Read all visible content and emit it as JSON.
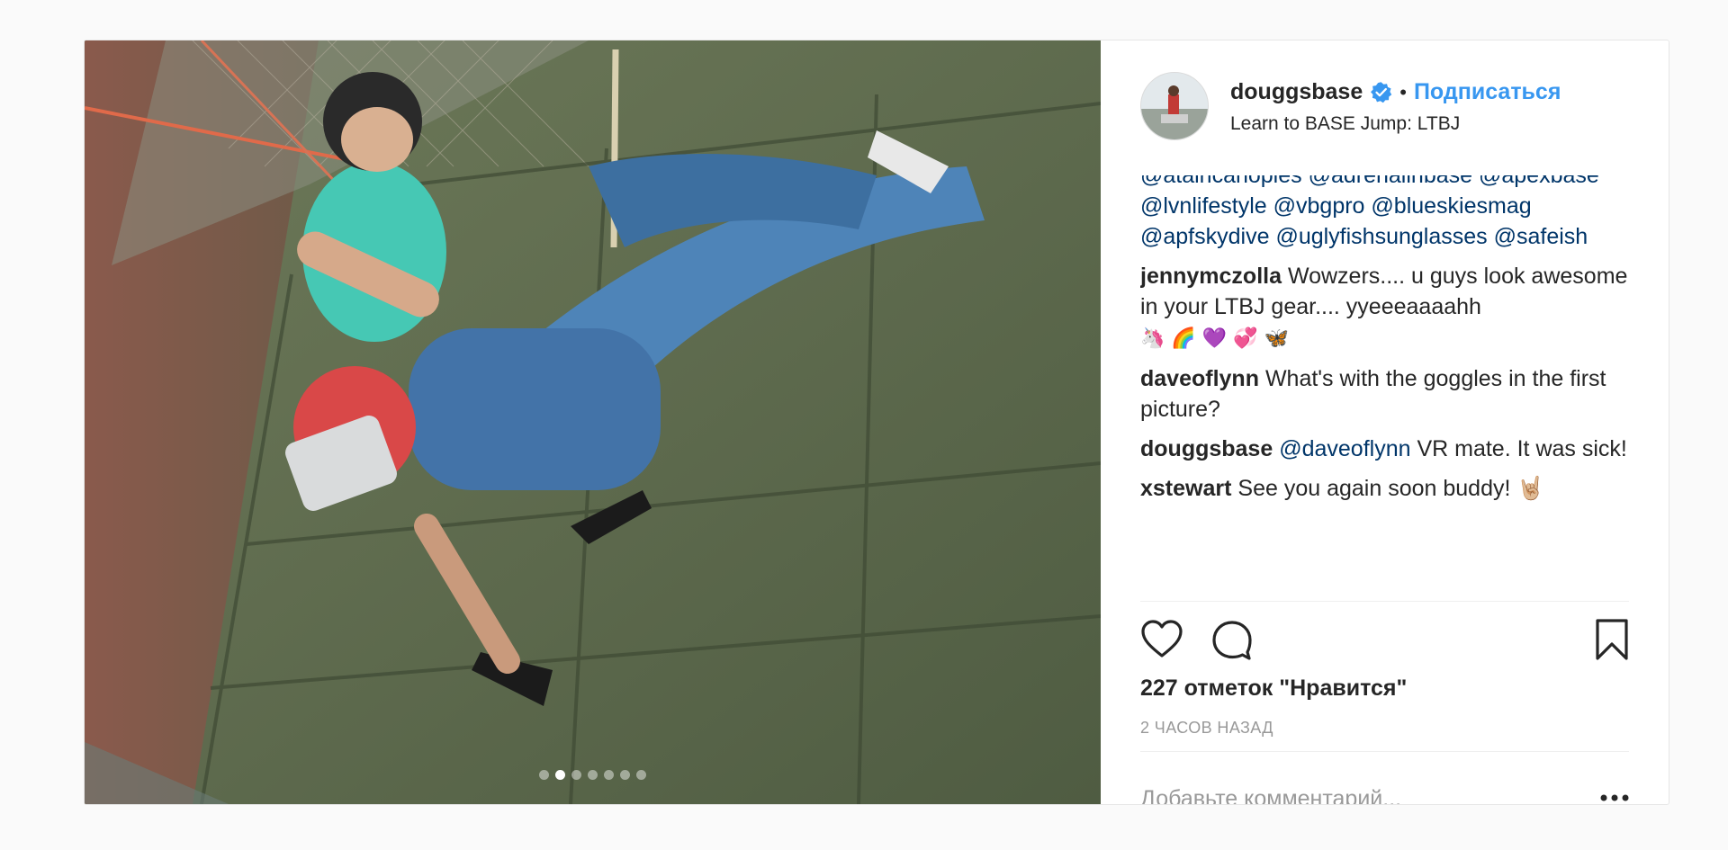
{
  "post": {
    "media": {
      "carousel_count": 7,
      "active_index": 1
    },
    "header": {
      "username": "douggsbase",
      "separator": "•",
      "follow_label": "Подписаться",
      "location": "Learn to BASE Jump: LTBJ"
    },
    "caption_tags": [
      "@atairicanopies @adrenalinbase @apexbase",
      "@lvnlifestyle @vbgpro @blueskiesmag",
      "@apfskydive @uglyfishsunglasses @safeish"
    ],
    "comments": [
      {
        "user": "jennymczolla",
        "text": "Wowzers.... u guys look awesome in your LTBJ gear.... yyeeeaaaahh",
        "emoji": "🦄 🌈 💜 💞 🦋"
      },
      {
        "user": "daveoflynn",
        "text": "What's with the goggles in the first picture?"
      },
      {
        "user": "douggsbase",
        "mention": "@daveoflynn",
        "text": " VR mate. It was sick!"
      },
      {
        "user": "xstewart",
        "text": "See you again soon buddy! 🤘🏼"
      }
    ],
    "likes": "227 отметок \"Нравится\"",
    "time": "2 ЧАСОВ НАЗАД",
    "comment_placeholder": "Добавьте комментарий...",
    "colors": {
      "accent": "#3897f0",
      "mention": "#003569",
      "muted": "#999999",
      "text": "#262626"
    },
    "icons": [
      "heart-icon",
      "comment-icon",
      "bookmark-icon",
      "more-icon",
      "verified-badge-icon"
    ]
  }
}
